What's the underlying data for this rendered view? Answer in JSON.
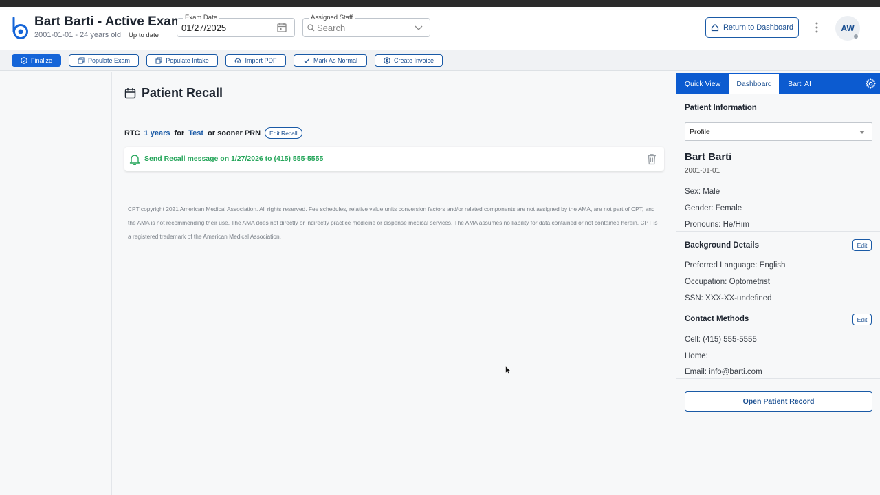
{
  "header": {
    "title": "Bart Barti - Active Exam",
    "subtitle": "2001-01-01 - 24 years old",
    "status": "Up to date",
    "exam_date_label": "Exam Date",
    "exam_date_value": "01/27/2025",
    "staff_label": "Assigned Staff",
    "staff_placeholder": "Search",
    "return_button": "Return to Dashboard",
    "avatar_initials": "AW"
  },
  "toolbar": {
    "buttons": [
      {
        "label": "Finalize"
      },
      {
        "label": "Populate Exam"
      },
      {
        "label": "Populate Intake"
      },
      {
        "label": "Import PDF"
      },
      {
        "label": "Mark As Normal"
      },
      {
        "label": "Create Invoice"
      }
    ]
  },
  "recall": {
    "title": "Patient Recall",
    "rtc": "RTC",
    "interval": "1 years",
    "for_word": "for",
    "reason": "Test",
    "suffix": "or sooner PRN",
    "edit_button": "Edit Recall",
    "message": "Send Recall message on 1/27/2026 to (415) 555-5555"
  },
  "cpt_notice": "CPT copyright 2021 American Medical Association. All rights reserved. Fee schedules, relative value units conversion factors and/or related components are not assigned by the AMA, are not part of CPT, and the AMA is not recommending their use. The AMA does not directly or indirectly practice medicine or dispense medical services. The AMA assumes no liability for data contained or not contained herein. CPT is a registered trademark of the American Medical Association.",
  "side_panel": {
    "tabs": [
      {
        "label": "Quick View"
      },
      {
        "label": "Dashboard"
      },
      {
        "label": "Barti AI"
      }
    ],
    "patient_info_title": "Patient Information",
    "profile_select": "Profile",
    "patient_name": "Bart Barti",
    "patient_dob": "2001-01-01",
    "sex": "Sex: Male",
    "gender": "Gender: Female",
    "pronouns": "Pronouns: He/Him",
    "background_title": "Background Details",
    "edit_label": "Edit",
    "language": "Preferred Language: English",
    "occupation": "Occupation: Optometrist",
    "ssn": "SSN: XXX-XX-undefined",
    "contact_title": "Contact Methods",
    "cell": "Cell: (415) 555-5555",
    "home": "Home:",
    "email": "Email: info@barti.com",
    "open_record_button": "Open Patient Record"
  },
  "colors": {
    "brand_blue": "#1565d8",
    "text_blue": "#1a4f91",
    "success_green": "#26a65b"
  }
}
